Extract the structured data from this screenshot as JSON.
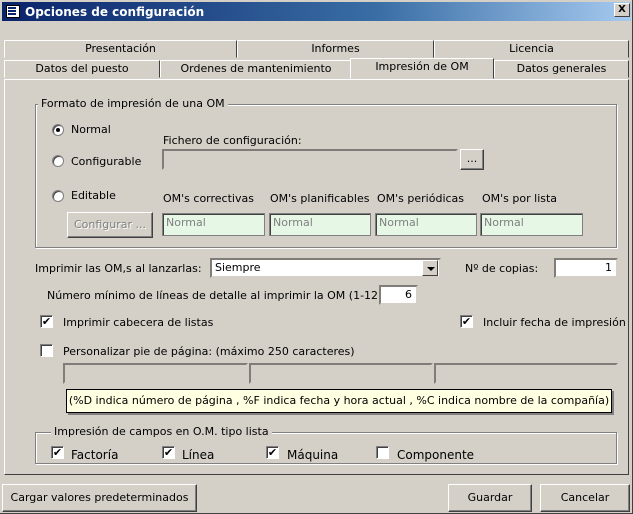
{
  "window": {
    "title": "Opciones de configuración",
    "close_label": "X"
  },
  "tabs_row_back": [
    "Presentación",
    "Informes",
    "Licencia"
  ],
  "tabs_row_front": [
    "Datos del puesto",
    "Ordenes de mantenimiento",
    "Impresión de OM",
    "Datos generales"
  ],
  "active_tab": "Impresión de OM",
  "format_group": {
    "legend": "Formato de impresión de una OM",
    "radio_normal": "Normal",
    "radio_configurable": "Configurable",
    "radio_editable": "Editable",
    "selected": "Normal",
    "config_file_label": "Fichero de configuración:",
    "config_file_value": "",
    "browse_label": "...",
    "configure_button": "Configurar ...",
    "col_correctivas": "OM's correctivas",
    "col_planificables": "OM's planificables",
    "col_periodicas": "OM's periódicas",
    "col_por_lista": "OM's por lista",
    "val_correctivas": "Normal",
    "val_planificables": "Normal",
    "val_periodicas": "Normal",
    "val_por_lista": "Normal"
  },
  "print_on_launch": {
    "label": "Imprimir las OM,s al lanzarlas:",
    "value": "Siempre"
  },
  "copies": {
    "label": "Nº de copias:",
    "value": "1"
  },
  "min_lines": {
    "label": "Número mínimo de líneas de detalle al imprimir la OM (1-12):",
    "value": "6"
  },
  "print_list_header": {
    "label": "Imprimir cabecera de listas",
    "checked": true
  },
  "include_print_date": {
    "label": "Incluir fecha de impresión",
    "checked": true
  },
  "custom_footer": {
    "label": "Personalizar pie de página:  (máximo 250 caracteres)",
    "checked": false,
    "fields": [
      "",
      "",
      ""
    ]
  },
  "tooltip": "(%D indica número de página , %F indica fecha y hora actual , %C indica nombre de la compañía)",
  "list_fields_group": {
    "legend": "Impresión de campos en O.M. tipo lista",
    "factoria": "Factoría",
    "linea": "Línea",
    "maquina": "Máquina",
    "componente": "Componente"
  },
  "footer": {
    "defaults_button": "Cargar valores predeterminados",
    "save_button": "Guardar",
    "cancel_button": "Cancelar"
  },
  "colors": {
    "title_bar": "#0a246a",
    "face": "#d4d0c8",
    "mint_field": "#e6f7e6",
    "tooltip_bg": "#ffffe1"
  }
}
